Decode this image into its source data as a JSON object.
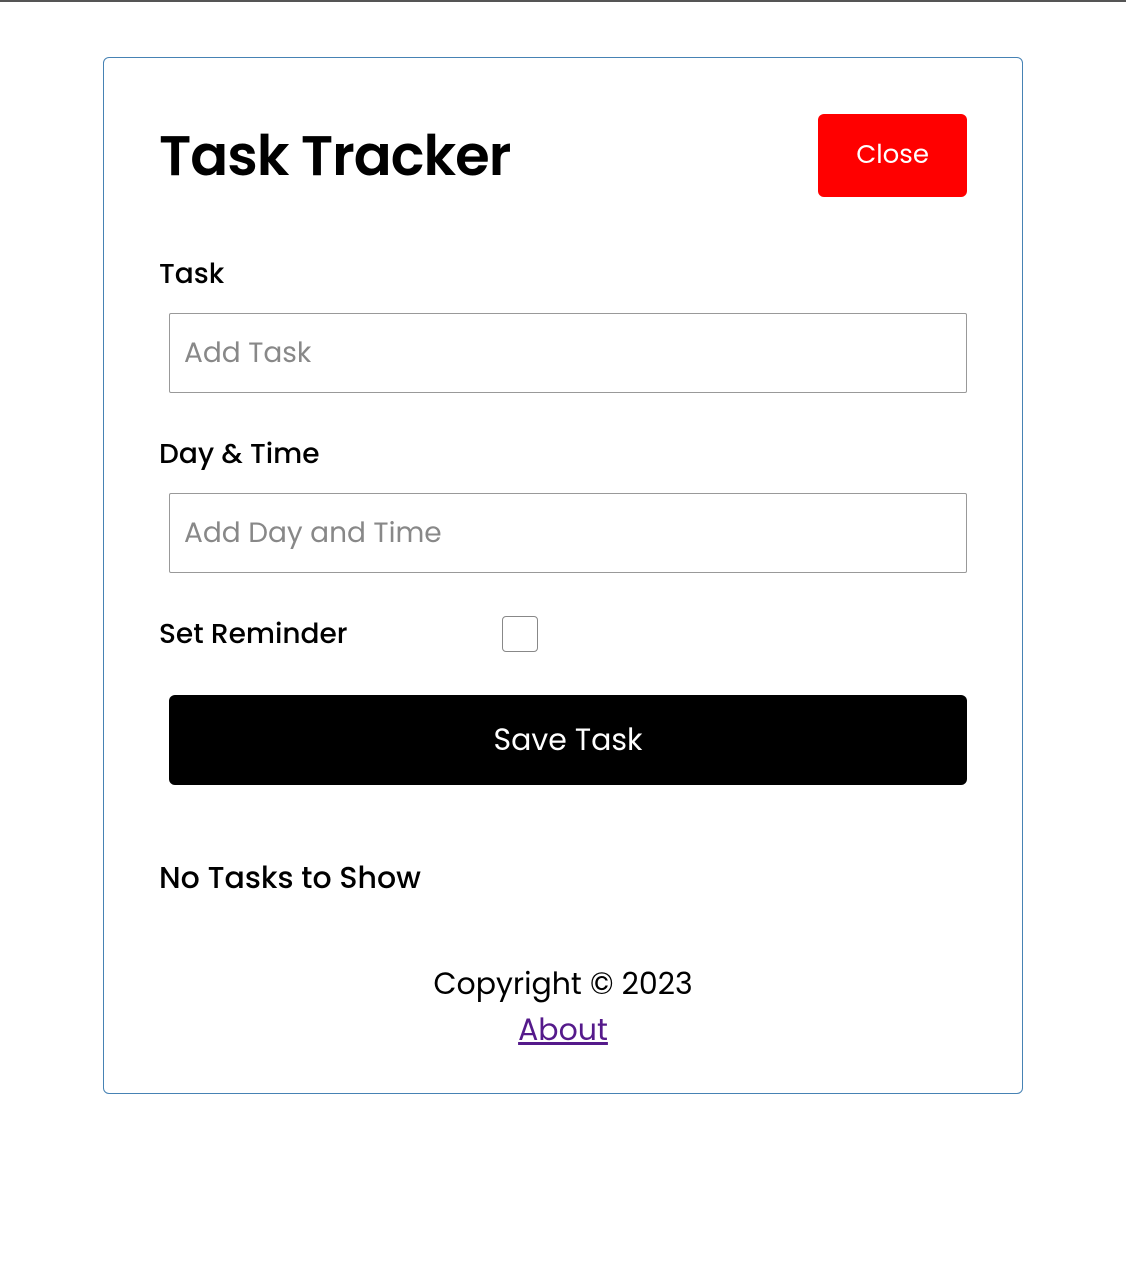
{
  "header": {
    "title": "Task Tracker",
    "close_label": "Close"
  },
  "form": {
    "task_label": "Task",
    "task_placeholder": "Add Task",
    "day_label": "Day & Time",
    "day_placeholder": "Add Day and Time",
    "reminder_label": "Set Reminder",
    "save_label": "Save Task"
  },
  "tasks": {
    "empty_message": "No Tasks to Show"
  },
  "footer": {
    "copyright": "Copyright © 2023",
    "about_label": "About"
  }
}
